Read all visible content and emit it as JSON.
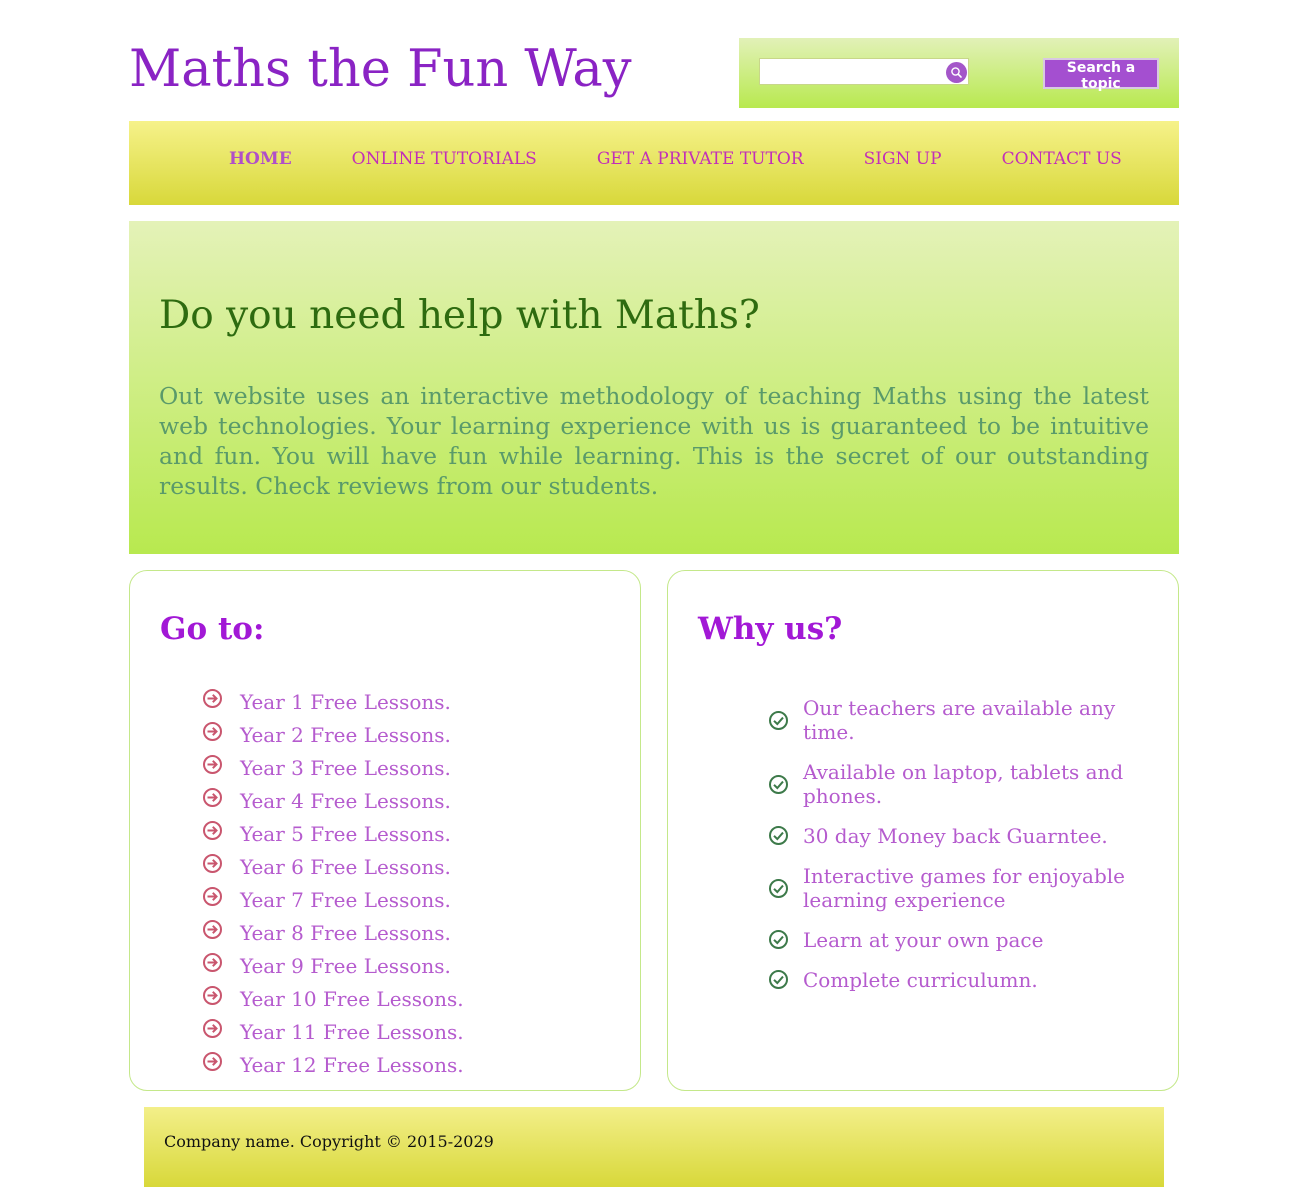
{
  "header": {
    "site_title": "Maths the Fun Way",
    "search": {
      "placeholder": "",
      "value": "",
      "button_label": "Search a topic"
    }
  },
  "nav": {
    "items": [
      {
        "label": "HOME",
        "active": true
      },
      {
        "label": "ONLINE TUTORIALS",
        "active": false
      },
      {
        "label": "GET A PRIVATE TUTOR",
        "active": false
      },
      {
        "label": "SIGN UP",
        "active": false
      },
      {
        "label": "CONTACT US",
        "active": false
      }
    ]
  },
  "hero": {
    "title": "Do you need help with Maths?",
    "text": "Out website uses an interactive methodology of teaching Maths using the latest web technologies. Your learning experience with us is guaranteed to be intuitive and fun. You will have fun while learning. This is the secret of our outstanding results. Check reviews from our students."
  },
  "goto": {
    "title": "Go to:",
    "icon": "arrow-circle-right-icon",
    "items": [
      "Year 1 Free Lessons.",
      "Year 2 Free Lessons.",
      "Year 3 Free Lessons.",
      "Year 4 Free Lessons.",
      "Year 5 Free Lessons.",
      "Year 6 Free Lessons.",
      "Year 7 Free Lessons.",
      "Year 8 Free Lessons.",
      "Year 9 Free Lessons.",
      "Year 10 Free Lessons.",
      "Year 11 Free Lessons.",
      "Year 12 Free Lessons."
    ]
  },
  "why": {
    "title": "Why us?",
    "icon": "check-circle-icon",
    "items": [
      "Our teachers are available any time.",
      "Available on laptop, tablets and phones.",
      "30 day Money back Guarntee.",
      "Interactive games for enjoyable learning experience",
      "Learn at your own pace",
      "Complete curriculumn."
    ]
  },
  "footer": {
    "text": "Company name. Copyright © 2015-2029"
  },
  "colors": {
    "title_purple": "#8a23c4",
    "nav_text": "#c22fb8",
    "hero_title": "#2e6b10",
    "hero_text": "#5a9a6a",
    "panel_title": "#a218d6",
    "list_text": "#b55bce",
    "arrow_icon": "#c9566e",
    "check_icon": "#3d7a4a",
    "search_button": "#a44fd0"
  }
}
